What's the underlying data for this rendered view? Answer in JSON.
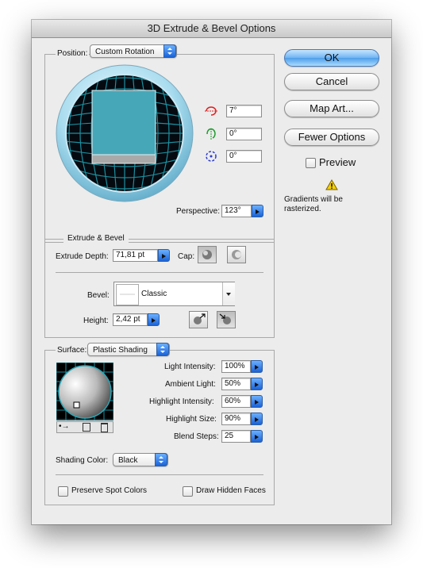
{
  "window": {
    "title": "3D Extrude & Bevel Options"
  },
  "position": {
    "label": "Position:",
    "preset": "Custom Rotation",
    "rot_x": "7°",
    "rot_y": "0°",
    "rot_z": "0°",
    "perspective_label": "Perspective:",
    "perspective": "123°"
  },
  "extrude": {
    "group_label": "Extrude & Bevel",
    "depth_label": "Extrude Depth:",
    "depth": "71,81 pt",
    "cap_label": "Cap:",
    "bevel_label": "Bevel:",
    "bevel": "Classic",
    "height_label": "Height:",
    "height": "2,42 pt"
  },
  "surface": {
    "label": "Surface:",
    "type": "Plastic Shading",
    "light_intensity_label": "Light Intensity:",
    "light_intensity": "100%",
    "ambient_label": "Ambient Light:",
    "ambient": "50%",
    "highlight_intensity_label": "Highlight Intensity:",
    "highlight_intensity": "60%",
    "highlight_size_label": "Highlight Size:",
    "highlight_size": "90%",
    "blend_steps_label": "Blend Steps:",
    "blend_steps": "25",
    "shading_color_label": "Shading Color:",
    "shading_color": "Black",
    "preserve_spot": "Preserve Spot Colors",
    "draw_hidden": "Draw Hidden Faces"
  },
  "buttons": {
    "ok": "OK",
    "cancel": "Cancel",
    "map_art": "Map Art...",
    "fewer_options": "Fewer Options"
  },
  "preview": {
    "label": "Preview",
    "checked": false
  },
  "warning": {
    "text": "Gradients will be rasterized."
  },
  "colors": {
    "accent": "#3a8ff0",
    "cube_face": "#46a7b8",
    "grid": "#1b8f9f"
  }
}
